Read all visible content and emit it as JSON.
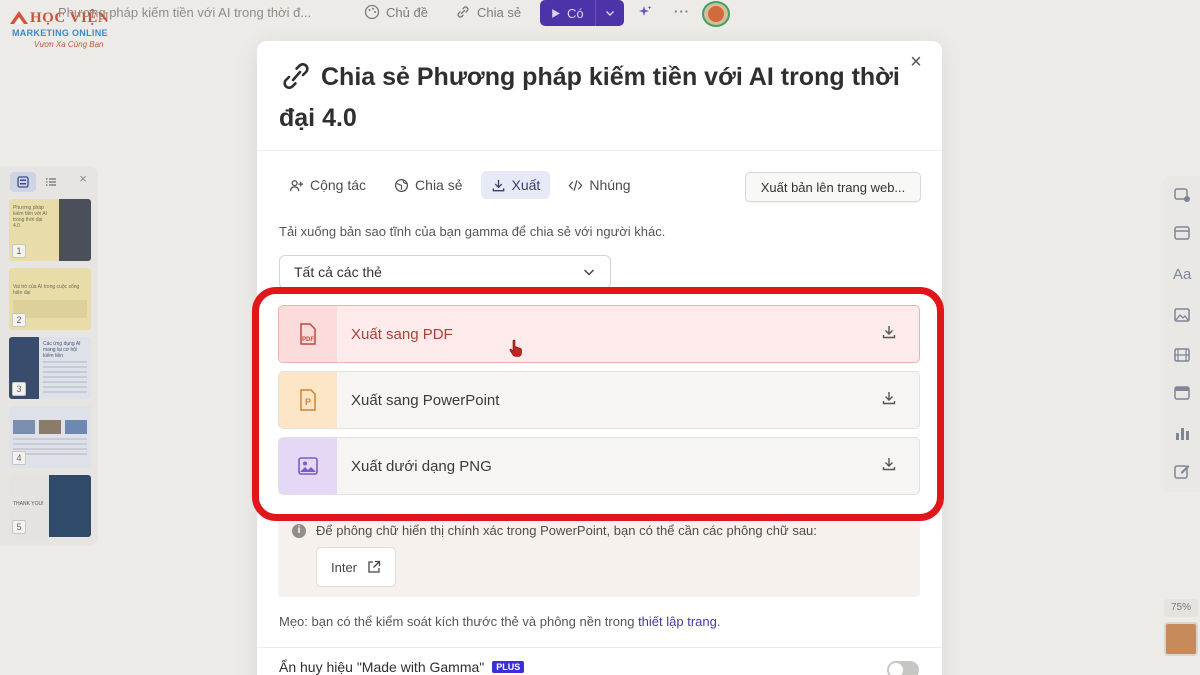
{
  "logo": {
    "name": "HỌC VIỆN",
    "sub": "MARKETING ONLINE",
    "tagline": "Vươn Xa Cùng Bạn"
  },
  "topbar": {
    "doc_title": "Phương pháp kiếm tiền với AI trong thời đ...",
    "theme_label": "Chủ đề",
    "share_label": "Chia sẻ",
    "present_label": "Có"
  },
  "thumbnails": [
    {
      "num": "1",
      "text": "Phương pháp kiếm tiền với AI trong thời đại 4.0"
    },
    {
      "num": "2",
      "text": "Vai trò của AI trong cuộc sống hiện đại"
    },
    {
      "num": "3",
      "text": "Các ứng dụng AI mang lại cơ hội kiếm tiền"
    },
    {
      "num": "4",
      "text": ""
    },
    {
      "num": "5",
      "text": "THANK YOU!"
    }
  ],
  "zoom": "75%",
  "modal": {
    "title": "Chia sẻ Phương pháp kiếm tiền với AI trong thời đại 4.0",
    "tabs": [
      {
        "label": "Cộng tác"
      },
      {
        "label": "Chia sẻ"
      },
      {
        "label": "Xuất"
      },
      {
        "label": "Nhúng"
      }
    ],
    "publish_label": "Xuất bản lên trang web...",
    "description": "Tải xuống bản sao tĩnh của bạn gamma để chia sẻ với người khác.",
    "select_value": "Tất cả các thẻ",
    "exports": [
      {
        "label": "Xuất sang PDF"
      },
      {
        "label": "Xuất sang PowerPoint"
      },
      {
        "label": "Xuất dưới dạng PNG"
      }
    ],
    "font_note": "Để phông chữ hiển thị chính xác trong PowerPoint, bạn có thể cần các phông chữ sau:",
    "font_name": "Inter",
    "tip_prefix": "Mẹo: bạn có thể kiểm soát kích thước thẻ và phông nền trong ",
    "tip_link": "thiết lập trang",
    "tip_suffix": ".",
    "badge_label": "Ẩn huy hiệu \"Made with Gamma\"",
    "plus_label": "PLUS"
  },
  "colors": {
    "accent": "#4d33a8",
    "highlight": "#e0161b",
    "pdf": "#ad4038"
  }
}
